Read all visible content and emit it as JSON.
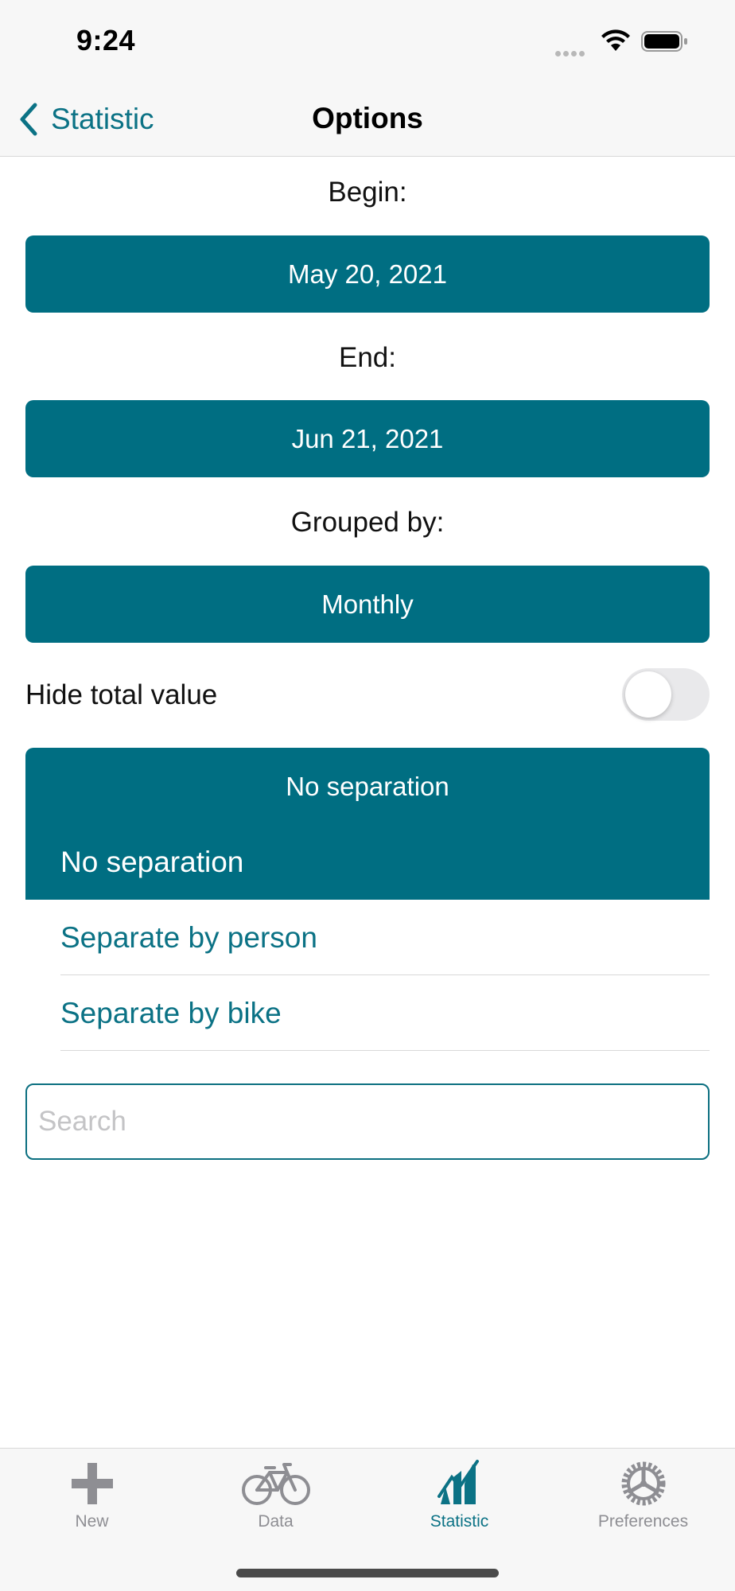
{
  "status_bar": {
    "time": "9:24"
  },
  "nav": {
    "back_label": "Statistic",
    "title": "Options"
  },
  "begin": {
    "label": "Begin:",
    "value": "May 20, 2021"
  },
  "end": {
    "label": "End:",
    "value": "Jun 21, 2021"
  },
  "grouped": {
    "label": "Grouped by:",
    "value": "Monthly"
  },
  "hide_total": {
    "label": "Hide total value",
    "on": false
  },
  "separation": {
    "selected": "No separation",
    "options": [
      {
        "label": "No separation",
        "selected": true
      },
      {
        "label": "Separate by person",
        "selected": false
      },
      {
        "label": "Separate by bike",
        "selected": false
      }
    ]
  },
  "search": {
    "placeholder": "Search",
    "value": ""
  },
  "tabs": [
    {
      "label": "New",
      "icon": "plus-icon",
      "active": false
    },
    {
      "label": "Data",
      "icon": "bike-icon",
      "active": false
    },
    {
      "label": "Statistic",
      "icon": "chart-icon",
      "active": true
    },
    {
      "label": "Preferences",
      "icon": "gear-icon",
      "active": false
    }
  ],
  "colors": {
    "accent": "#006e82",
    "link": "#0b7285",
    "inactive": "#8e8e93"
  }
}
